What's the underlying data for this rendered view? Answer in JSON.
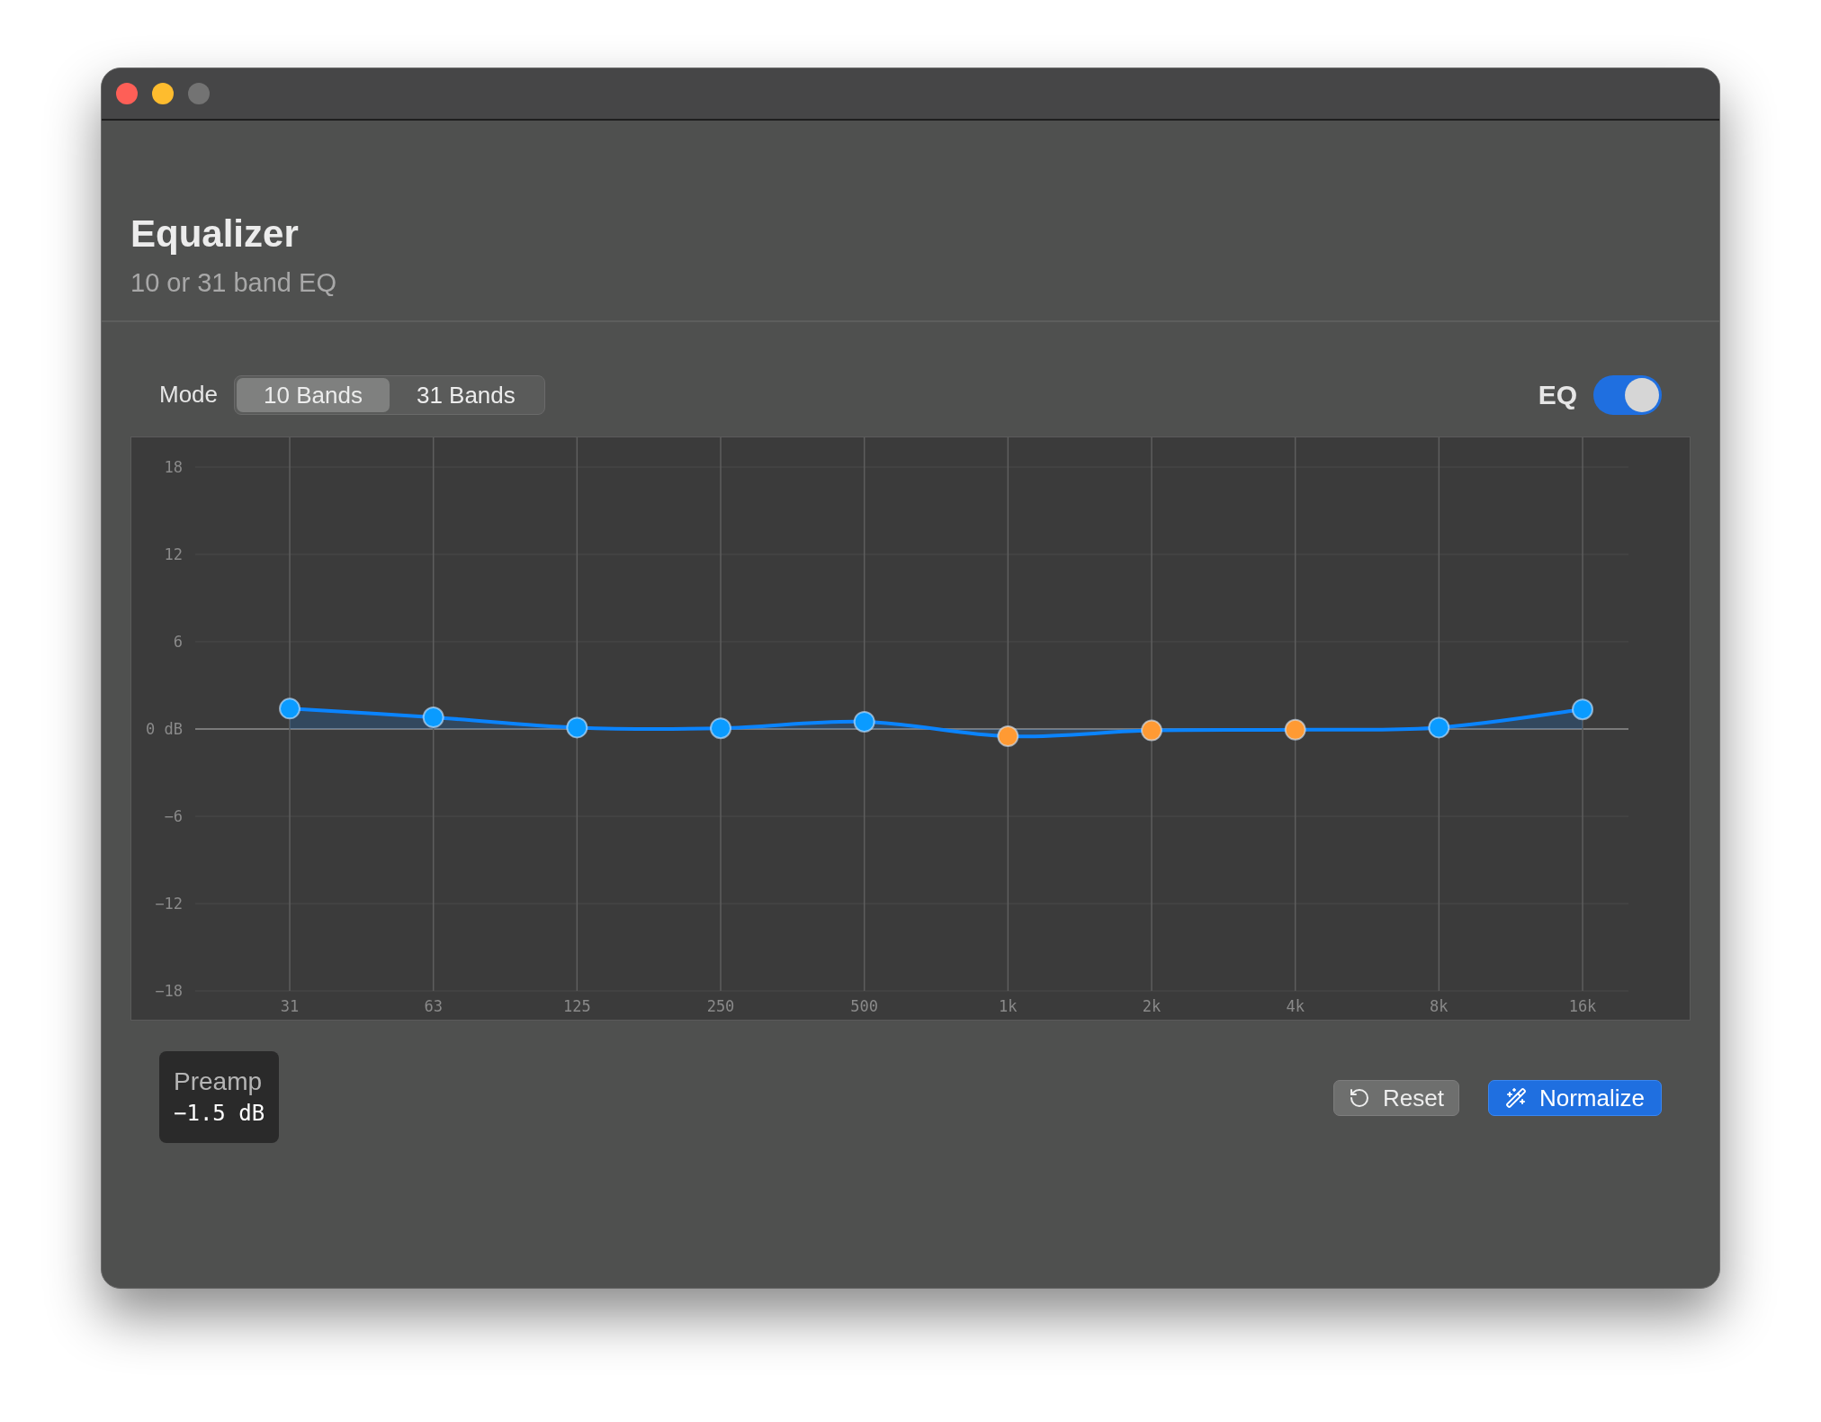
{
  "header": {
    "title": "Equalizer",
    "subtitle": "10 or 31 band EQ"
  },
  "mode": {
    "label": "Mode",
    "options": [
      {
        "label": "10 Bands",
        "selected": true
      },
      {
        "label": "31 Bands",
        "selected": false
      }
    ]
  },
  "eq_toggle": {
    "label": "EQ",
    "on": true
  },
  "chart_data": {
    "type": "line",
    "categories": [
      "31",
      "63",
      "125",
      "250",
      "500",
      "1k",
      "2k",
      "4k",
      "8k",
      "16k"
    ],
    "grid": true,
    "series": [
      {
        "color": "#0a84ff",
        "marker": true,
        "values": [
          1.4,
          0.8,
          0.1,
          0.05,
          0.5,
          -0.5,
          -0.1,
          -0.05,
          0.1,
          1.35
        ]
      }
    ],
    "ylim": [
      -18,
      18
    ],
    "yticks": [
      18,
      12,
      6,
      {
        "value": 0,
        "label": "0 dB"
      },
      -6,
      -12,
      -18
    ]
  },
  "preamp": {
    "label": "Preamp",
    "value": "−1.5 dB"
  },
  "buttons": [
    {
      "kind": "reset",
      "label": "Reset"
    },
    {
      "kind": "normalize",
      "label": "Normalize"
    }
  ]
}
